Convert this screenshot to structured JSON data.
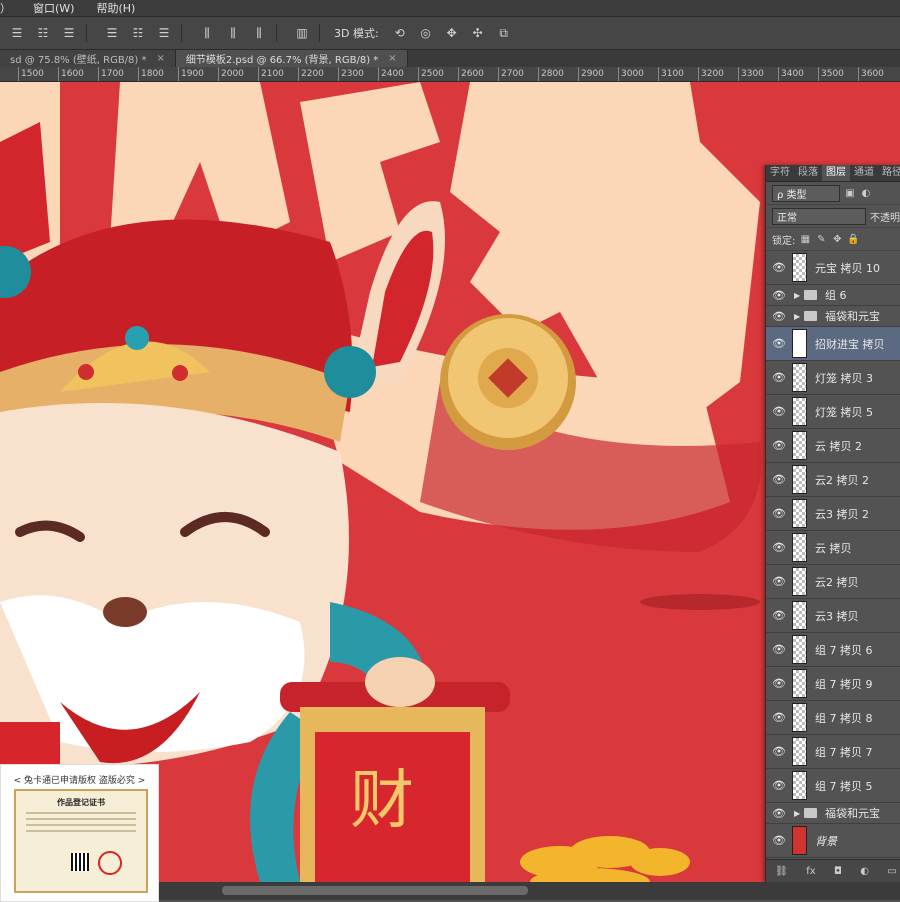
{
  "menubar": {
    "items": [
      "）",
      "窗口(W)",
      "帮助(H)"
    ]
  },
  "options_bar": {
    "mode_label": "3D 模式:"
  },
  "tabs": [
    {
      "label": "sd @ 75.8% (壁纸, RGB/8) *",
      "close": "×"
    },
    {
      "label": "细节模板2.psd @ 66.7% (背景, RGB/8) *",
      "close": "×"
    }
  ],
  "ruler": {
    "ticks": [
      "1500",
      "1600",
      "1700",
      "1800",
      "1900",
      "2000",
      "2100",
      "2200",
      "2300",
      "2400",
      "2500",
      "2600",
      "2700",
      "2800",
      "2900",
      "3000",
      "3100",
      "3200",
      "3300",
      "3400",
      "3500",
      "3600"
    ]
  },
  "canvas": {
    "scroll_text": "财"
  },
  "layers_panel": {
    "tabs": [
      "字符",
      "段落",
      "图层",
      "通道",
      "路径"
    ],
    "active_tab": "图层",
    "filter_label": "ρ 类型",
    "blend_mode": "正常",
    "opacity_label": "不透明",
    "lock_label": "锁定:",
    "layers": [
      {
        "name": "元宝 拷贝 10",
        "type": "layer"
      },
      {
        "name": "组 6",
        "type": "group"
      },
      {
        "name": "福袋和元宝",
        "type": "group"
      },
      {
        "name": "招财进宝 拷贝",
        "type": "layer",
        "selected": true
      },
      {
        "name": "灯笼 拷贝 3",
        "type": "layer"
      },
      {
        "name": "灯笼 拷贝 5",
        "type": "layer"
      },
      {
        "name": "云 拷贝 2",
        "type": "layer"
      },
      {
        "name": "云2 拷贝 2",
        "type": "layer"
      },
      {
        "name": "云3 拷贝 2",
        "type": "layer"
      },
      {
        "name": "云 拷贝",
        "type": "layer"
      },
      {
        "name": "云2 拷贝",
        "type": "layer"
      },
      {
        "name": "云3 拷贝",
        "type": "layer"
      },
      {
        "name": "组 7 拷贝 6",
        "type": "layer"
      },
      {
        "name": "组 7 拷贝 9",
        "type": "layer"
      },
      {
        "name": "组 7 拷贝 8",
        "type": "layer"
      },
      {
        "name": "组 7 拷贝 7",
        "type": "layer"
      },
      {
        "name": "组 7 拷贝 5",
        "type": "layer"
      },
      {
        "name": "福袋和元宝",
        "type": "group"
      },
      {
        "name": "背景",
        "type": "background"
      }
    ],
    "footer_icons": [
      "link-icon",
      "fx-icon",
      "mask-icon",
      "adjustment-icon",
      "folder-icon"
    ]
  },
  "watermark": {
    "caption": "< 兔卡通已申请版权 盗版必究 >",
    "cert_title": "作品登记证书"
  }
}
